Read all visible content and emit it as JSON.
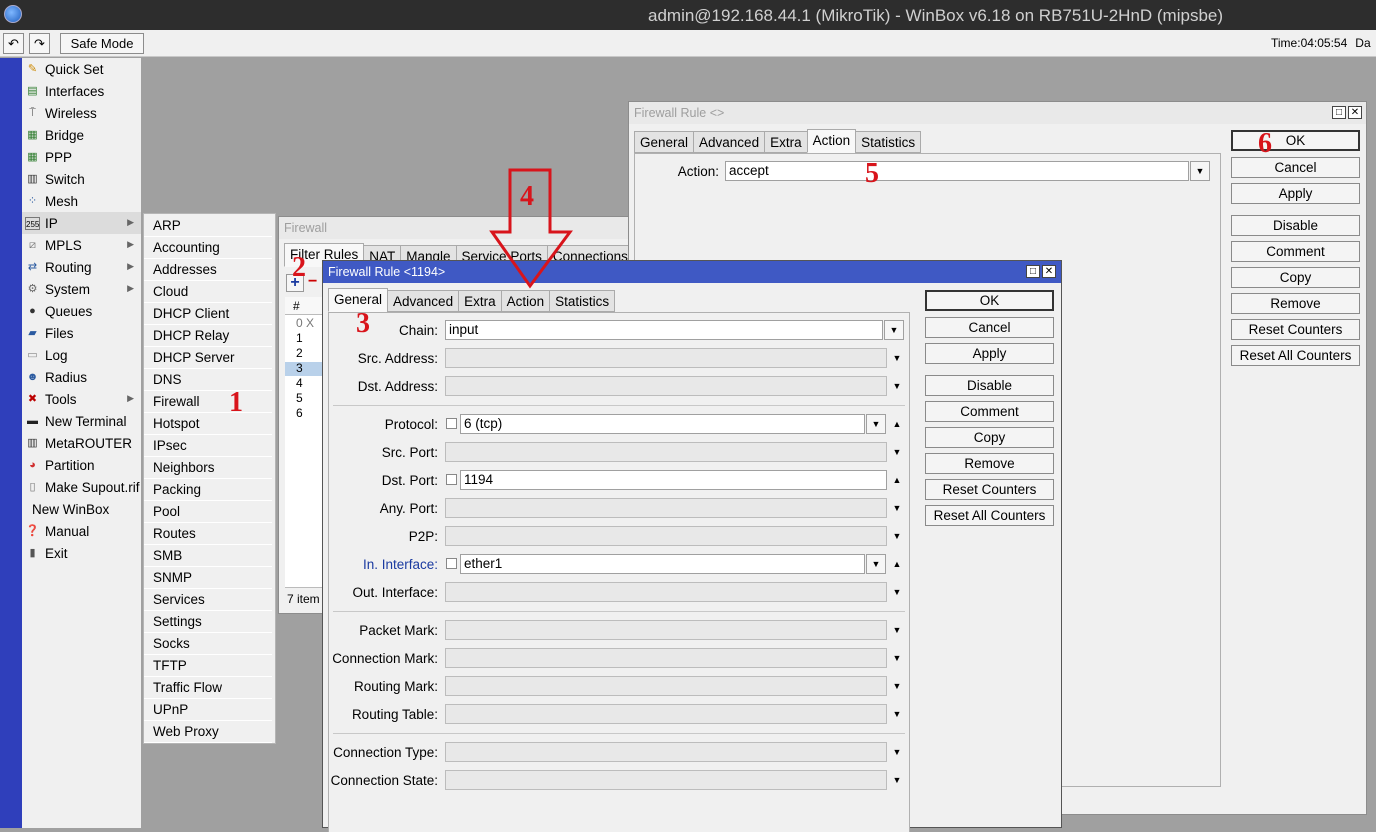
{
  "window": {
    "title": "admin@192.168.44.1 (MikroTik) - WinBox v6.18 on RB751U-2HnD (mipsbe)"
  },
  "toolbar": {
    "undo_icon": "undo-icon",
    "redo_icon": "redo-icon",
    "safe_mode": "Safe Mode",
    "time_label": "Time:",
    "time_value": "04:05:54",
    "date_label": "Da"
  },
  "menu": [
    {
      "label": "Quick Set",
      "icon": "quick-set-icon"
    },
    {
      "label": "Interfaces",
      "icon": "interfaces-icon"
    },
    {
      "label": "Wireless",
      "icon": "wireless-icon"
    },
    {
      "label": "Bridge",
      "icon": "bridge-icon"
    },
    {
      "label": "PPP",
      "icon": "ppp-icon"
    },
    {
      "label": "Switch",
      "icon": "switch-icon"
    },
    {
      "label": "Mesh",
      "icon": "mesh-icon"
    },
    {
      "label": "IP",
      "icon": "ip-icon"
    },
    {
      "label": "MPLS",
      "icon": "mpls-icon"
    },
    {
      "label": "Routing",
      "icon": "routing-icon"
    },
    {
      "label": "System",
      "icon": "system-icon"
    },
    {
      "label": "Queues",
      "icon": "queues-icon"
    },
    {
      "label": "Files",
      "icon": "files-icon"
    },
    {
      "label": "Log",
      "icon": "log-icon"
    },
    {
      "label": "Radius",
      "icon": "radius-icon"
    },
    {
      "label": "Tools",
      "icon": "tools-icon"
    },
    {
      "label": "New Terminal",
      "icon": "terminal-icon"
    },
    {
      "label": "MetaROUTER",
      "icon": "metarouter-icon"
    },
    {
      "label": "Partition",
      "icon": "partition-icon"
    },
    {
      "label": "Make Supout.rif",
      "icon": "supout-icon"
    },
    {
      "label": "New WinBox",
      "icon": ""
    },
    {
      "label": "Manual",
      "icon": "manual-icon"
    },
    {
      "label": "Exit",
      "icon": "exit-icon"
    }
  ],
  "ip_submenu": [
    "ARP",
    "Accounting",
    "Addresses",
    "Cloud",
    "DHCP Client",
    "DHCP Relay",
    "DHCP Server",
    "DNS",
    "Firewall",
    "Hotspot",
    "IPsec",
    "Neighbors",
    "Packing",
    "Pool",
    "Routes",
    "SMB",
    "SNMP",
    "Services",
    "Settings",
    "Socks",
    "TFTP",
    "Traffic Flow",
    "UPnP",
    "Web Proxy"
  ],
  "firewall": {
    "title": "Firewall",
    "tabs": [
      "Filter Rules",
      "NAT",
      "Mangle",
      "Service Ports",
      "Connections"
    ],
    "col_hash": "#",
    "rows": [
      "0",
      "X",
      "1",
      "2",
      "3",
      "4",
      "5",
      "6"
    ],
    "status": "7 item"
  },
  "rule_action": {
    "title": "Firewall Rule <>",
    "tabs": [
      "General",
      "Advanced",
      "Extra",
      "Action",
      "Statistics"
    ],
    "action_label": "Action:",
    "action_value": "accept",
    "buttons": [
      "OK",
      "Cancel",
      "Apply",
      "Disable",
      "Comment",
      "Copy",
      "Remove",
      "Reset Counters",
      "Reset All Counters"
    ]
  },
  "rule_general": {
    "title": "Firewall Rule <1194>",
    "tabs": [
      "General",
      "Advanced",
      "Extra",
      "Action",
      "Statistics"
    ],
    "fields": {
      "chain": {
        "label": "Chain:",
        "value": "input"
      },
      "src_address": {
        "label": "Src. Address:",
        "value": ""
      },
      "dst_address": {
        "label": "Dst. Address:",
        "value": ""
      },
      "protocol": {
        "label": "Protocol:",
        "value": "6 (tcp)"
      },
      "src_port": {
        "label": "Src. Port:",
        "value": ""
      },
      "dst_port": {
        "label": "Dst. Port:",
        "value": "1194"
      },
      "any_port": {
        "label": "Any. Port:",
        "value": ""
      },
      "p2p": {
        "label": "P2P:",
        "value": ""
      },
      "in_interface": {
        "label": "In. Interface:",
        "value": "ether1"
      },
      "out_interface": {
        "label": "Out. Interface:",
        "value": ""
      },
      "packet_mark": {
        "label": "Packet Mark:",
        "value": ""
      },
      "connection_mark": {
        "label": "Connection Mark:",
        "value": ""
      },
      "routing_mark": {
        "label": "Routing Mark:",
        "value": ""
      },
      "routing_table": {
        "label": "Routing Table:",
        "value": ""
      },
      "connection_type": {
        "label": "Connection Type:",
        "value": ""
      },
      "connection_state": {
        "label": "Connection State:",
        "value": ""
      }
    },
    "buttons": [
      "OK",
      "Cancel",
      "Apply",
      "Disable",
      "Comment",
      "Copy",
      "Remove",
      "Reset Counters",
      "Reset All Counters"
    ]
  },
  "annotations": {
    "a1": "1",
    "a2": "2",
    "a3": "3",
    "a4": "4",
    "a5": "5",
    "a6": "6"
  },
  "colors": {
    "annotation": "#d8141b",
    "active_title": "#3f59c4",
    "sidebar_strip": "#2f3fbb"
  }
}
